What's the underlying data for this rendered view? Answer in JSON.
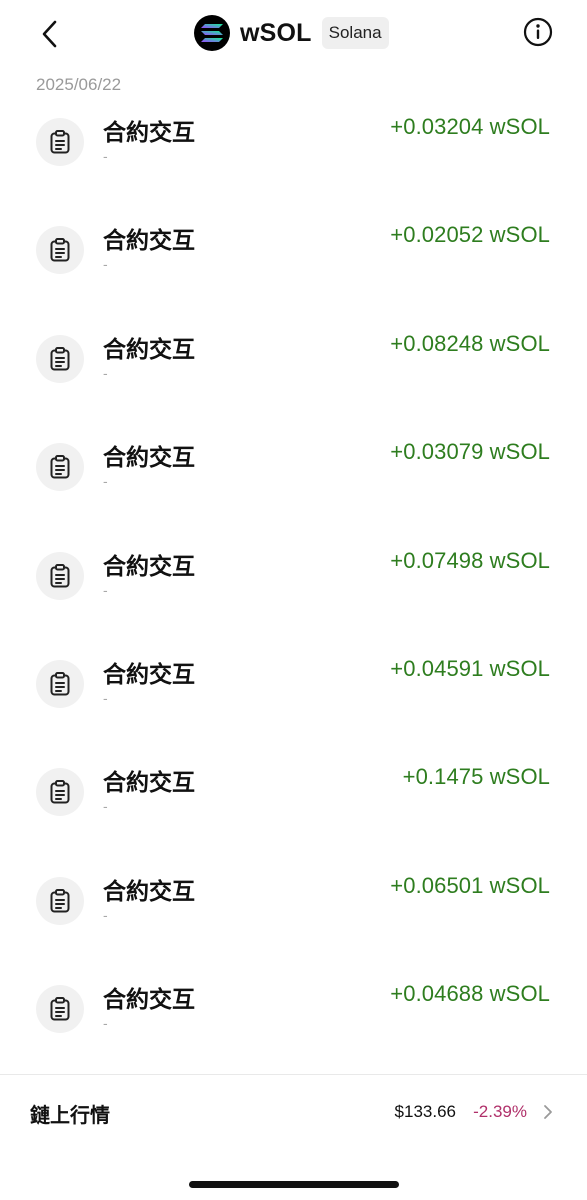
{
  "header": {
    "token_name": "wSOL",
    "chain": "Solana",
    "icons": {
      "back": "chevron-left-icon",
      "info": "info-icon",
      "logo": "solana-logo"
    }
  },
  "date": "2025/06/22",
  "transactions": [
    {
      "title": "合約交互",
      "subtitle": "-",
      "amount": "+0.03204 wSOL",
      "icon": "clipboard-icon"
    },
    {
      "title": "合約交互",
      "subtitle": "-",
      "amount": "+0.02052 wSOL",
      "icon": "clipboard-icon"
    },
    {
      "title": "合約交互",
      "subtitle": "-",
      "amount": "+0.08248 wSOL",
      "icon": "clipboard-icon"
    },
    {
      "title": "合約交互",
      "subtitle": "-",
      "amount": "+0.03079 wSOL",
      "icon": "clipboard-icon"
    },
    {
      "title": "合約交互",
      "subtitle": "-",
      "amount": "+0.07498 wSOL",
      "icon": "clipboard-icon"
    },
    {
      "title": "合約交互",
      "subtitle": "-",
      "amount": "+0.04591 wSOL",
      "icon": "clipboard-icon"
    },
    {
      "title": "合約交互",
      "subtitle": "-",
      "amount": "+0.1475 wSOL",
      "icon": "clipboard-icon"
    },
    {
      "title": "合約交互",
      "subtitle": "-",
      "amount": "+0.06501 wSOL",
      "icon": "clipboard-icon"
    },
    {
      "title": "合約交互",
      "subtitle": "-",
      "amount": "+0.04688 wSOL",
      "icon": "clipboard-icon"
    }
  ],
  "footer": {
    "label": "鏈上行情",
    "price": "$133.66",
    "change": "-2.39%"
  },
  "colors": {
    "positive_amount": "#2e7d1f",
    "negative_change": "#b0306a",
    "muted": "#9a9a9a"
  }
}
